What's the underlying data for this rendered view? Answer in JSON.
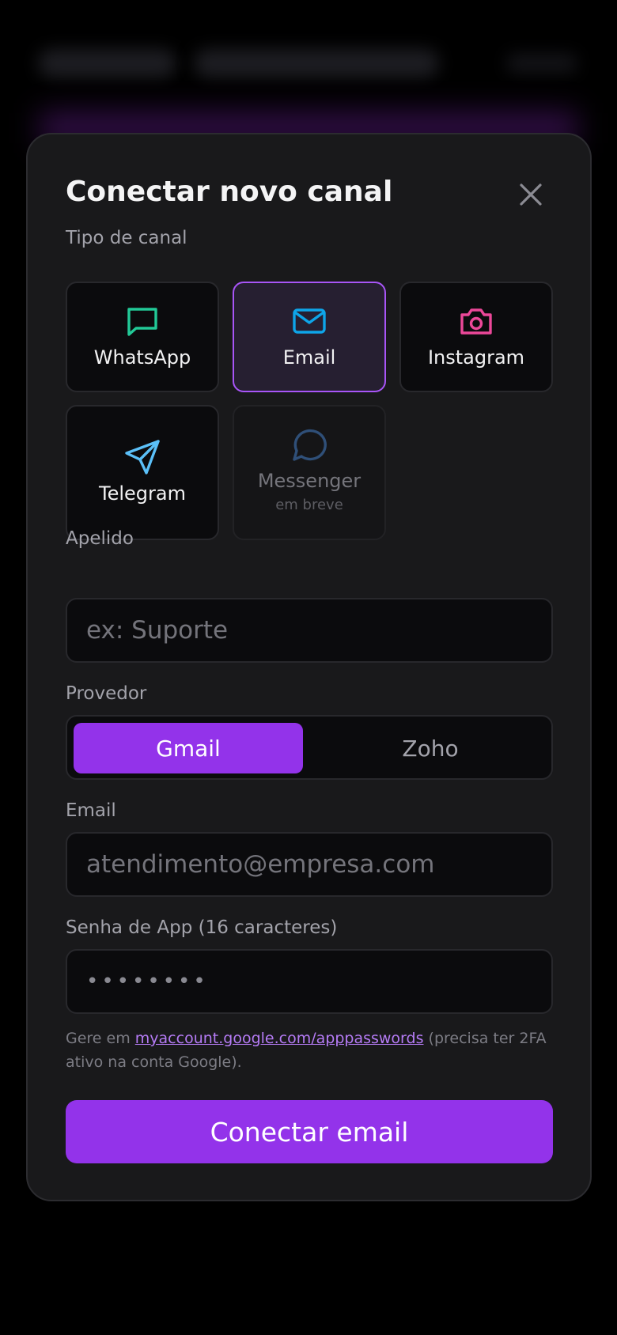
{
  "modal": {
    "title": "Conectar novo canal",
    "channel_type_label": "Tipo de canal",
    "channels": [
      {
        "label": "WhatsApp",
        "icon": "chat-bubble-icon",
        "color": "#22c997"
      },
      {
        "label": "Email",
        "icon": "mail-icon",
        "color": "#0ea5e9",
        "selected": true
      },
      {
        "label": "Instagram",
        "icon": "camera-icon",
        "color": "#ec4899"
      },
      {
        "label": "Telegram",
        "icon": "send-icon",
        "color": "#5bc0f8"
      },
      {
        "label": "Messenger",
        "icon": "message-circle-icon",
        "color": "#2f4f78",
        "sub": "em breve",
        "disabled": true
      }
    ],
    "nickname": {
      "label": "Apelido",
      "placeholder": "ex: Suporte",
      "value": ""
    },
    "provider": {
      "label": "Provedor",
      "options": [
        "Gmail",
        "Zoho"
      ],
      "selected": "Gmail"
    },
    "email": {
      "label": "Email",
      "placeholder": "atendimento@empresa.com",
      "value": ""
    },
    "app_password": {
      "label": "Senha de App (16 caracteres)",
      "value": "••••••••"
    },
    "hint": {
      "prefix": "Gere em ",
      "link": "myaccount.google.com/apppasswords",
      "suffix": " (precisa ter 2FA ativo na conta Google)."
    },
    "submit_label": "Conectar email"
  },
  "colors": {
    "accent": "#9333ea",
    "accent_border": "#a855f7",
    "panel": "#19191b"
  }
}
